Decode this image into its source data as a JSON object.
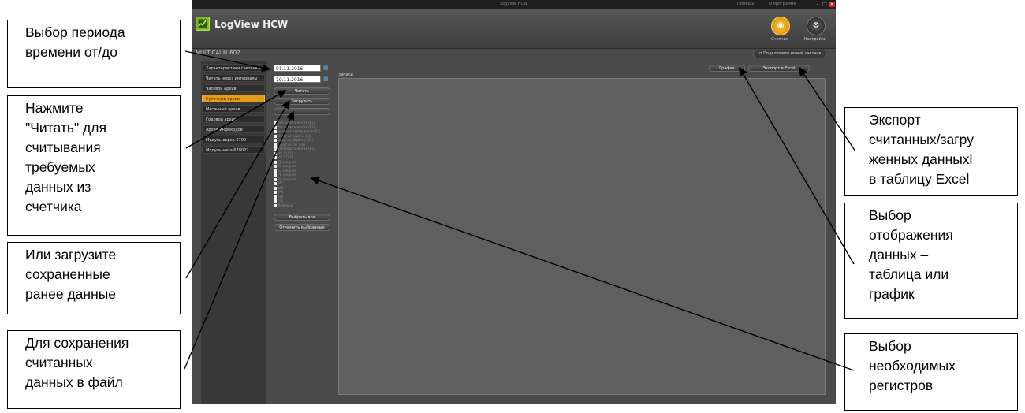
{
  "window": {
    "title": "LogView HCW",
    "help": "Помощь",
    "about": "О программе",
    "minimize": "–",
    "maximize": "□",
    "close": "×"
  },
  "header": {
    "app_name": "LogView HCW",
    "meter_label": "Счетчик",
    "settings_label": "Настройки"
  },
  "device": {
    "name": "MULTICAL® 602",
    "connect_button": "Подключите новый счетчик"
  },
  "sidebar": {
    "items": [
      {
        "label": "Характеристики счетчика",
        "active": false
      },
      {
        "label": "Читать через интервалы",
        "active": false
      },
      {
        "label": "Часовой архив",
        "active": false
      },
      {
        "label": "Суточный архив",
        "active": true
      },
      {
        "label": "Месячный архив",
        "active": false
      },
      {
        "label": "Годовой архив",
        "active": false
      },
      {
        "label": "Архив инфокодов",
        "active": false
      },
      {
        "label": "Модуль верха 6709",
        "active": false
      },
      {
        "label": "Модуль низа 678022",
        "active": false
      }
    ]
  },
  "controls": {
    "date_from": "01.11.2016",
    "date_to": "10.11.2016",
    "read_button": "Читать",
    "load_button": "Загрузить",
    "save_button": "",
    "select_all_button": "Выбрать все",
    "deselect_button": "Отменить выбранные"
  },
  "registers": [
    "Тепловая энергия (E1)",
    "Тепловая энергия (E2)",
    "Энергия охлаждения (E3)",
    "Энергия подачи (E4)",
    "Энергия обратки (E5)",
    "Энергия tap (E6)",
    "Тепловая энергия (E7)",
    "Vol 1 (V1)",
    "Vol 2 (V2)",
    "T1 среднее",
    "T2 среднее",
    "T3 среднее",
    "P1 среднее",
    "P2 среднее",
    "TA1",
    "TA2",
    "TA3",
    "TL2",
    "TL3",
    "Инфокод"
  ],
  "records": {
    "label": "Записи",
    "graph_button": "График",
    "export_button": "Экспорт в Excel"
  },
  "annotations": {
    "period": "Выбор периода\nвремени от/до",
    "read": "Нажмите\n\"Читать\" для\nсчитывания\nтребуемых\nданных из\nсчетчика",
    "load": "Или загрузите\nсохраненные\nранее данные",
    "save": "Для сохранения\nсчитанных\nданных в файл",
    "export": "Экспорт\nсчитанных/загру\nженных данныхl\nв таблицу Excel",
    "view": "Выбор\nотображения\nданных –\nтаблица или\nграфик",
    "registers": "Выбор\nнеобходимых\nрегистров"
  }
}
